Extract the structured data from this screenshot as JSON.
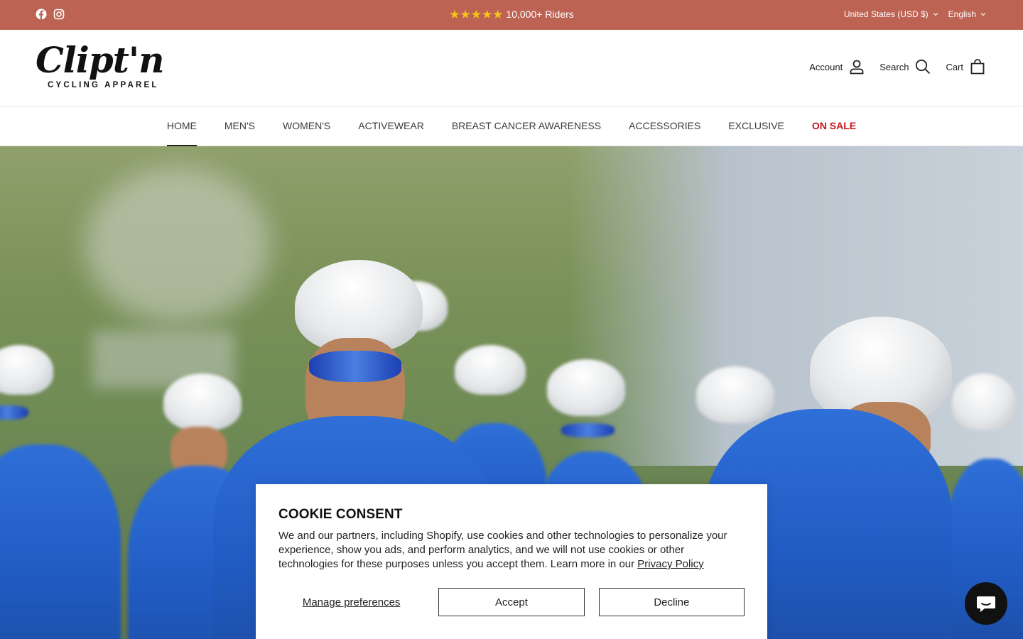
{
  "announcement": {
    "stars": "★★★★★",
    "promo_text": "10,000+ Riders",
    "currency": "United States (USD $)",
    "language": "English",
    "social": [
      "facebook-icon",
      "instagram-icon"
    ],
    "background": "#bd6354"
  },
  "header": {
    "logo_wordmark": "Clipt'n",
    "logo_tagline": "CYCLING APPAREL",
    "account_label": "Account",
    "search_label": "Search",
    "cart_label": "Cart"
  },
  "nav": {
    "items": [
      {
        "label": "HOME"
      },
      {
        "label": "MEN'S"
      },
      {
        "label": "WOMEN'S"
      },
      {
        "label": "ACTIVEWEAR"
      },
      {
        "label": "BREAST CANCER AWARENESS"
      },
      {
        "label": "ACCESSORIES"
      },
      {
        "label": "EXCLUSIVE"
      },
      {
        "label": "ON SALE"
      }
    ],
    "active": "HOME",
    "sale_color": "#c4161c"
  },
  "cookie": {
    "title": "COOKIE CONSENT",
    "body": "We and our partners, including Shopify, use cookies and other technologies to personalize your experience, show you ads, and perform analytics, and we will not use cookies or other technologies for these purposes unless you accept them. Learn more in our ",
    "privacy_link": "Privacy Policy",
    "manage_label": "Manage preferences",
    "accept_label": "Accept",
    "decline_label": "Decline"
  },
  "chat": {
    "icon": "chat-bubble-icon"
  }
}
